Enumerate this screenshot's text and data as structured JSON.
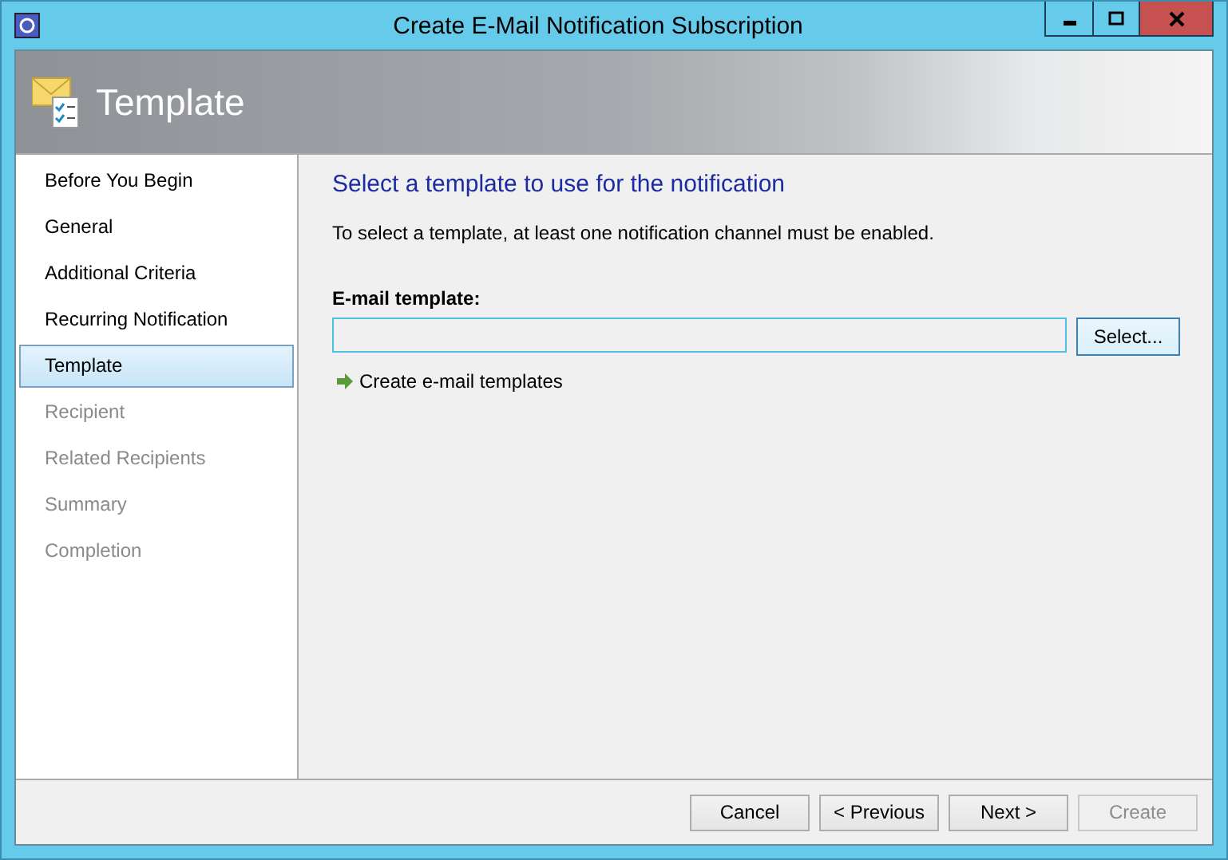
{
  "window": {
    "title": "Create E-Mail Notification Subscription"
  },
  "header": {
    "title": "Template"
  },
  "sidebar": {
    "items": [
      {
        "label": "Before You Begin",
        "selected": false,
        "disabled": false
      },
      {
        "label": "General",
        "selected": false,
        "disabled": false
      },
      {
        "label": "Additional Criteria",
        "selected": false,
        "disabled": false
      },
      {
        "label": "Recurring Notification",
        "selected": false,
        "disabled": false
      },
      {
        "label": "Template",
        "selected": true,
        "disabled": false
      },
      {
        "label": "Recipient",
        "selected": false,
        "disabled": true
      },
      {
        "label": "Related Recipients",
        "selected": false,
        "disabled": true
      },
      {
        "label": "Summary",
        "selected": false,
        "disabled": true
      },
      {
        "label": "Completion",
        "selected": false,
        "disabled": true
      }
    ]
  },
  "content": {
    "heading": "Select a template to use for the notification",
    "description": "To select a template, at least one notification channel must be enabled.",
    "field_label": "E-mail template:",
    "select_button": "Select...",
    "link": "Create e-mail templates"
  },
  "buttons": [
    {
      "label": "Cancel",
      "disabled": false
    },
    {
      "label": "< Previous",
      "disabled": false
    },
    {
      "label": "Next >",
      "disabled": false
    },
    {
      "label": "Create",
      "disabled": true
    }
  ]
}
